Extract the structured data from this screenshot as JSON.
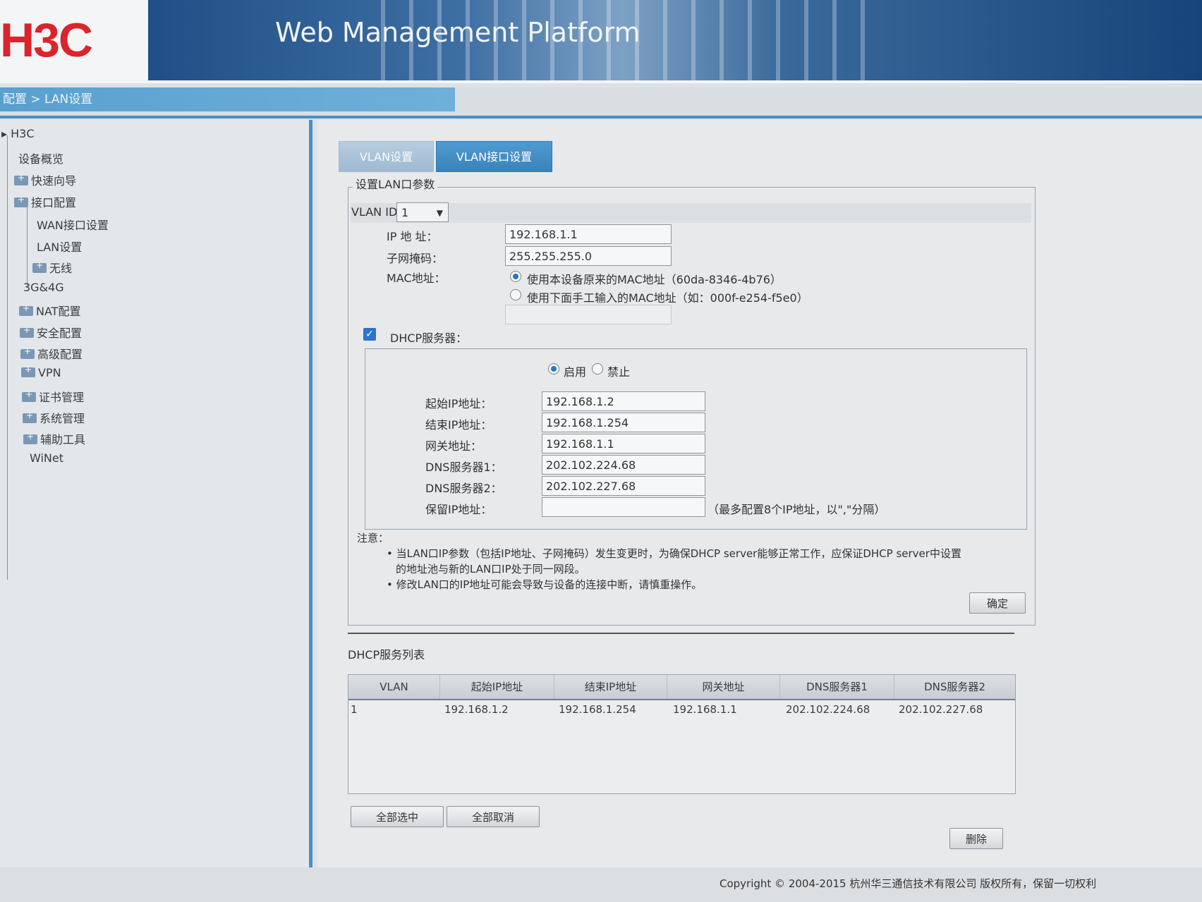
{
  "header": {
    "logo": "H3C",
    "title": "Web Management Platform"
  },
  "breadcrumb": "配置 > LAN设置",
  "sidebar": {
    "items": [
      {
        "label": "H3C"
      },
      {
        "label": "设备概览"
      },
      {
        "label": "快速向导"
      },
      {
        "label": "接口配置"
      },
      {
        "label": "WAN接口设置"
      },
      {
        "label": "LAN设置"
      },
      {
        "label": "无线"
      },
      {
        "label": "3G&4G"
      },
      {
        "label": "NAT配置"
      },
      {
        "label": "安全配置"
      },
      {
        "label": "高级配置"
      },
      {
        "label": "VPN"
      },
      {
        "label": "证书管理"
      },
      {
        "label": "系统管理"
      },
      {
        "label": "辅助工具"
      },
      {
        "label": "WiNet"
      }
    ]
  },
  "tabs": [
    {
      "label": "VLAN设置",
      "active": false
    },
    {
      "label": "VLAN接口设置",
      "active": true
    }
  ],
  "form": {
    "legend": "设置LAN口参数",
    "vlan_id_label": "VLAN ID",
    "vlan_id_value": "1",
    "ip_label": "IP 地 址：",
    "ip_value": "192.168.1.1",
    "mask_label": "子网掩码：",
    "mask_value": "255.255.255.0",
    "mac_label": "MAC地址：",
    "mac_option1": "使用本设备原来的MAC地址（60da-8346-4b76）",
    "mac_option2": "使用下面手工输入的MAC地址（如：000f-e254-f5e0）",
    "dhcp_label": "DHCP服务器：",
    "dhcp_enable": "启用",
    "dhcp_disable": "禁止",
    "start_ip_label": "起始IP地址：",
    "start_ip_value": "192.168.1.2",
    "end_ip_label": "结束IP地址：",
    "end_ip_value": "192.168.1.254",
    "gateway_label": "网关地址：",
    "gateway_value": "192.168.1.1",
    "dns1_label": "DNS服务器1：",
    "dns1_value": "202.102.224.68",
    "dns2_label": "DNS服务器2：",
    "dns2_value": "202.102.227.68",
    "reserved_label": "保留IP地址：",
    "reserved_value": "",
    "reserved_hint": "（最多配置8个IP地址，以\",\"分隔）",
    "note_title": "注意：",
    "note1_line1": "当LAN口IP参数（包括IP地址、子网掩码）发生变更时，为确保DHCP server能够正常工作，应保证DHCP server中设置",
    "note1_line2": "的地址池与新的LAN口IP处于同一网段。",
    "note2": "修改LAN口的IP地址可能会导致与设备的连接中断，请慎重操作。",
    "confirm_button": "确定"
  },
  "dhcp_list": {
    "title": "DHCP服务列表",
    "columns": [
      "VLAN",
      "起始IP地址",
      "结束IP地址",
      "网关地址",
      "DNS服务器1",
      "DNS服务器2"
    ],
    "rows": [
      [
        "1",
        "192.168.1.2",
        "192.168.1.254",
        "192.168.1.1",
        "202.102.224.68",
        "202.102.227.68"
      ]
    ],
    "select_all": "全部选中",
    "deselect_all": "全部取消",
    "delete": "删除"
  },
  "footer": "Copyright © 2004-2015 杭州华三通信技术有限公司 版权所有，保留一切权利",
  "colors": {
    "accent": "#3a82bb",
    "logo_red": "#d9252b",
    "radio_blue": "#2c73c9"
  }
}
